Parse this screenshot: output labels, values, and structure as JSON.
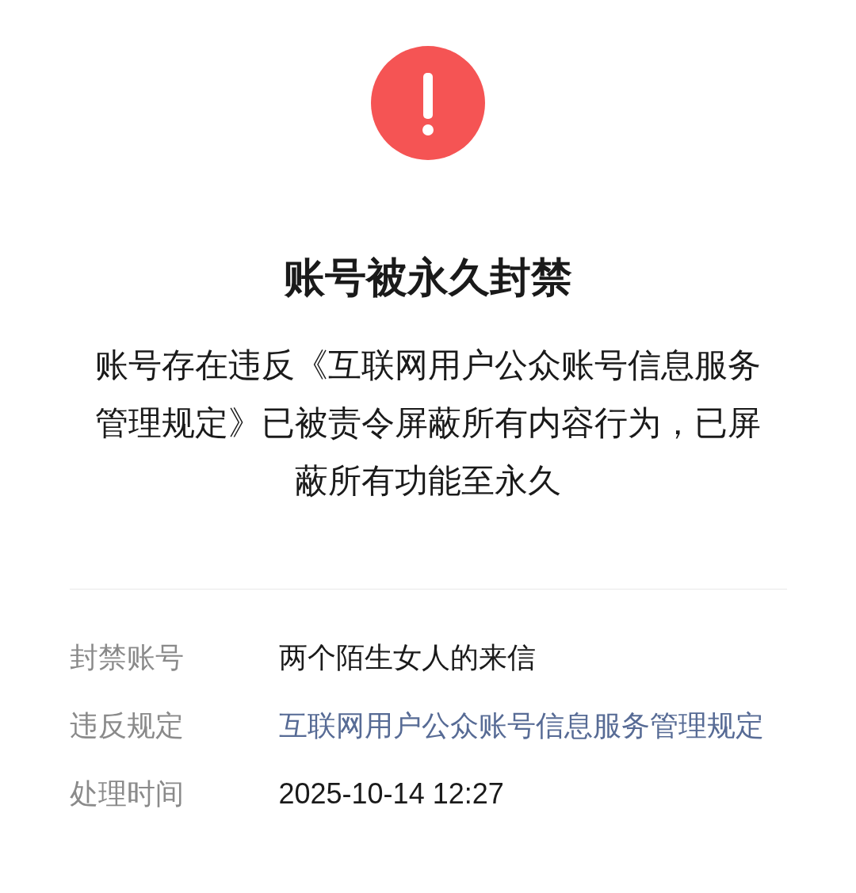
{
  "title": "账号被永久封禁",
  "description": "账号存在违反《互联网用户公众账号信息服务管理规定》已被责令屏蔽所有内容行为，已屏蔽所有功能至永久",
  "details": [
    {
      "label": "封禁账号",
      "value": "两个陌生女人的来信",
      "kind": "text"
    },
    {
      "label": "违反规定",
      "value": "互联网用户公众账号信息服务管理规定",
      "kind": "link"
    },
    {
      "label": "处理时间",
      "value": "2025-10-14 12:27",
      "kind": "text"
    }
  ]
}
